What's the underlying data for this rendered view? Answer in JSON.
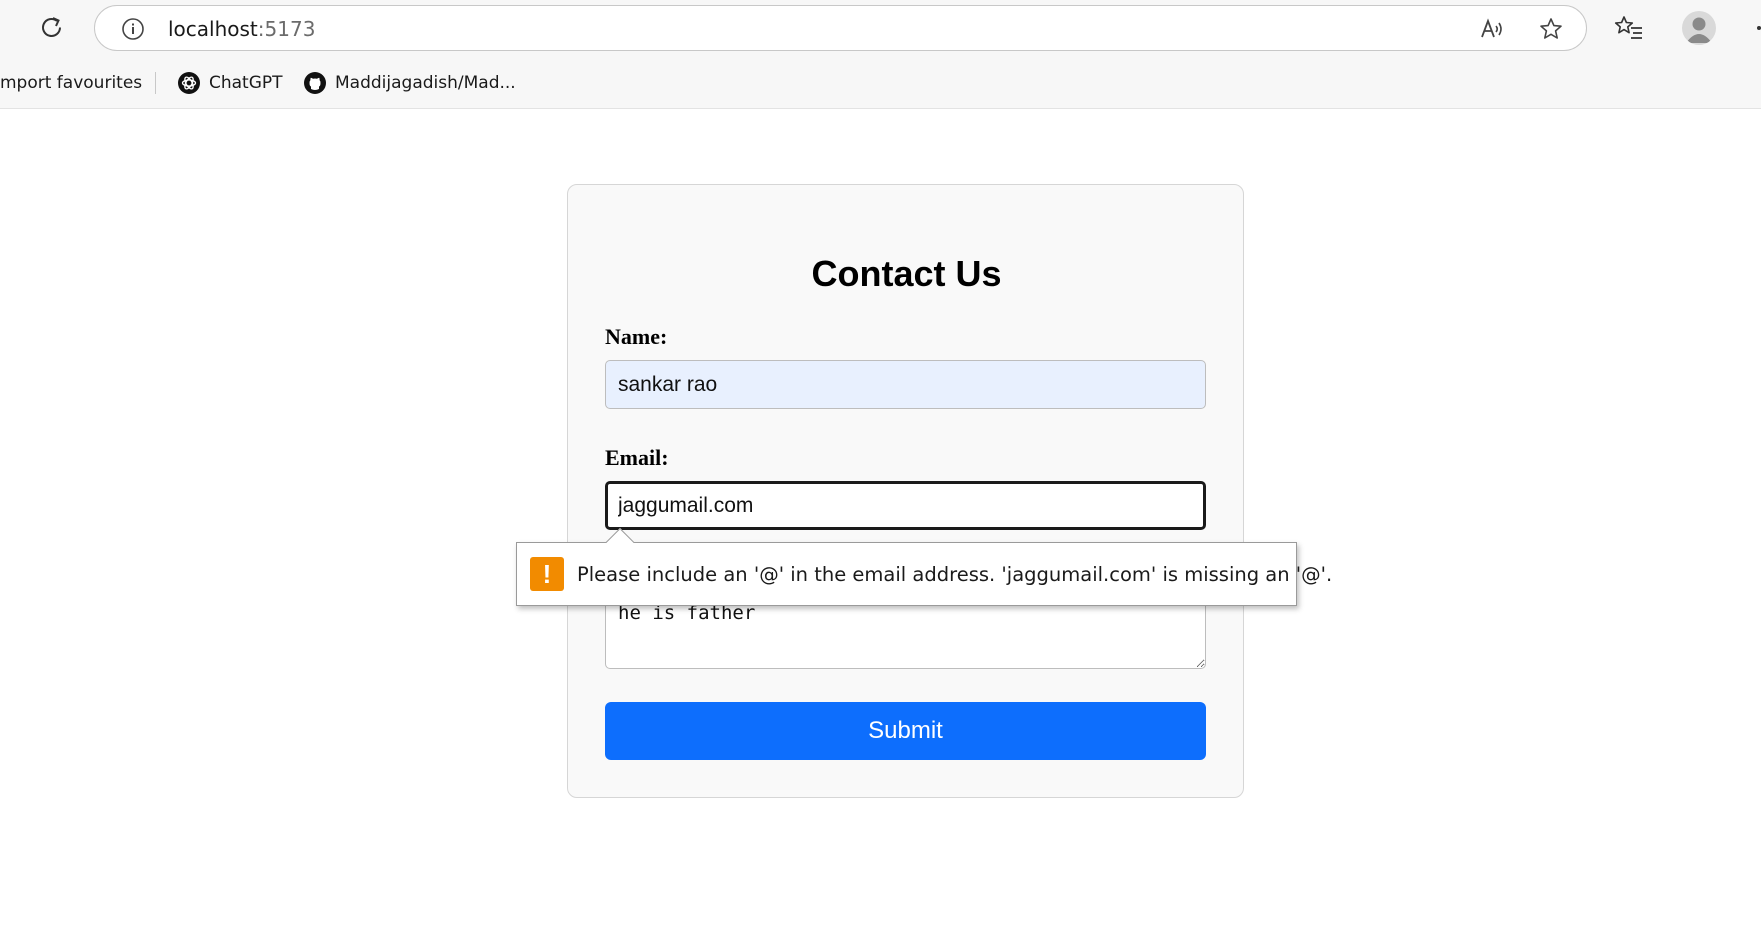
{
  "browser": {
    "url_host": "localhost",
    "url_port": ":5173"
  },
  "bookmarks": {
    "items": [
      {
        "label": "mport favourites"
      },
      {
        "label": "ChatGPT",
        "icon": "chatgpt-icon"
      },
      {
        "label": "Maddijagadish/Mad...",
        "icon": "github-icon"
      }
    ]
  },
  "form": {
    "title": "Contact Us",
    "name_label": "Name:",
    "name_value": "sankar rao",
    "email_label": "Email:",
    "email_value": "jaggumail.com",
    "message_value": "he is father",
    "submit_label": "Submit"
  },
  "validation": {
    "message": "Please include an '@' in the email address. 'jaggumail.com' is missing an '@'.",
    "icon": "!"
  },
  "colors": {
    "submit": "#0d6efd",
    "autofill": "#e8f0fe",
    "warning": "#f28b00"
  }
}
